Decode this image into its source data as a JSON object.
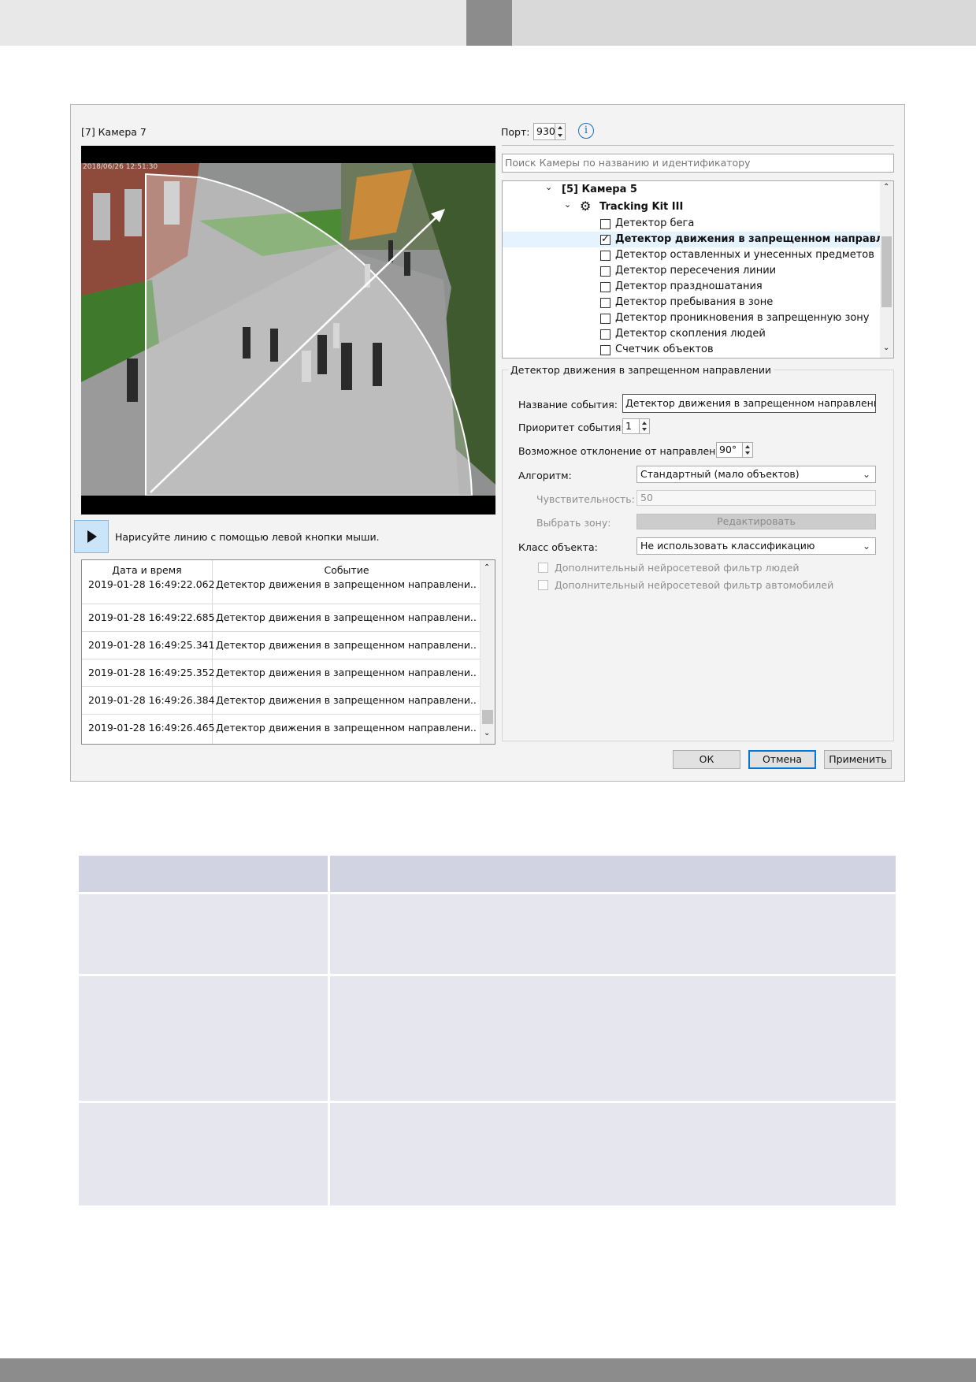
{
  "dialog": {
    "camera_title": "[7] Камера 7",
    "port_label": "Порт:",
    "port_value": "930",
    "search_placeholder": "Поиск Камеры по названию и идентификатору",
    "draw_hint": "Нарисуйте линию с помощью левой кнопки мыши.",
    "video_timestamp": "2018/06/26 12:51:30",
    "tree": {
      "camera": "[5] Камера 5",
      "kit": "Tracking Kit III",
      "detectors": [
        {
          "label": "Детектор бега",
          "checked": false
        },
        {
          "label": "Детектор движения в запрещенном направл...",
          "checked": true
        },
        {
          "label": "Детектор оставленных и унесенных предметов",
          "checked": false
        },
        {
          "label": "Детектор пересечения линии",
          "checked": false
        },
        {
          "label": "Детектор праздношатания",
          "checked": false
        },
        {
          "label": "Детектор пребывания в зоне",
          "checked": false
        },
        {
          "label": "Детектор проникновения в запрещенную зону",
          "checked": false
        },
        {
          "label": "Детектор скопления людей",
          "checked": false
        },
        {
          "label": "Счетчик объектов",
          "checked": false
        }
      ]
    },
    "settings": {
      "group_title": "Детектор движения в запрещенном направлении",
      "event_name_label": "Название события:",
      "event_name_value": "Детектор движения в запрещенном направлении",
      "priority_label": "Приоритет события:",
      "priority_value": "1",
      "deviation_label": "Возможное отклонение от направления:",
      "deviation_value": "90°",
      "algorithm_label": "Алгоритм:",
      "algorithm_value": "Стандартный (мало объектов)",
      "sensitivity_label": "Чувствительность:",
      "sensitivity_value": "50",
      "zone_label": "Выбрать зону:",
      "edit_button": "Редактировать",
      "class_label": "Класс объекта:",
      "class_value": "Не использовать классификацию",
      "nn_people": "Дополнительный нейросетевой фильтр людей",
      "nn_cars": "Дополнительный нейросетевой фильтр автомобилей"
    },
    "events": {
      "col_date": "Дата и время",
      "col_event": "Событие",
      "rows": [
        {
          "date": "2019-01-28 16:49:22.062",
          "event": "Детектор движения в запрещенном направлени..."
        },
        {
          "date": "2019-01-28 16:49:22.685",
          "event": "Детектор движения в запрещенном направлени..."
        },
        {
          "date": "2019-01-28 16:49:25.341",
          "event": "Детектор движения в запрещенном направлени..."
        },
        {
          "date": "2019-01-28 16:49:25.352",
          "event": "Детектор движения в запрещенном направлени..."
        },
        {
          "date": "2019-01-28 16:49:26.384",
          "event": "Детектор движения в запрещенном направлени..."
        },
        {
          "date": "2019-01-28 16:49:26.465",
          "event": "Детектор движения в запрещенном направлени..."
        }
      ]
    },
    "buttons": {
      "ok": "ОК",
      "cancel": "Отмена",
      "apply": "Применить"
    }
  },
  "colors": {
    "accent": "#0078d7",
    "selected_row": "#e5f3ff",
    "table_head": "#d1d3e3",
    "table_body": "#e6e6ef"
  }
}
